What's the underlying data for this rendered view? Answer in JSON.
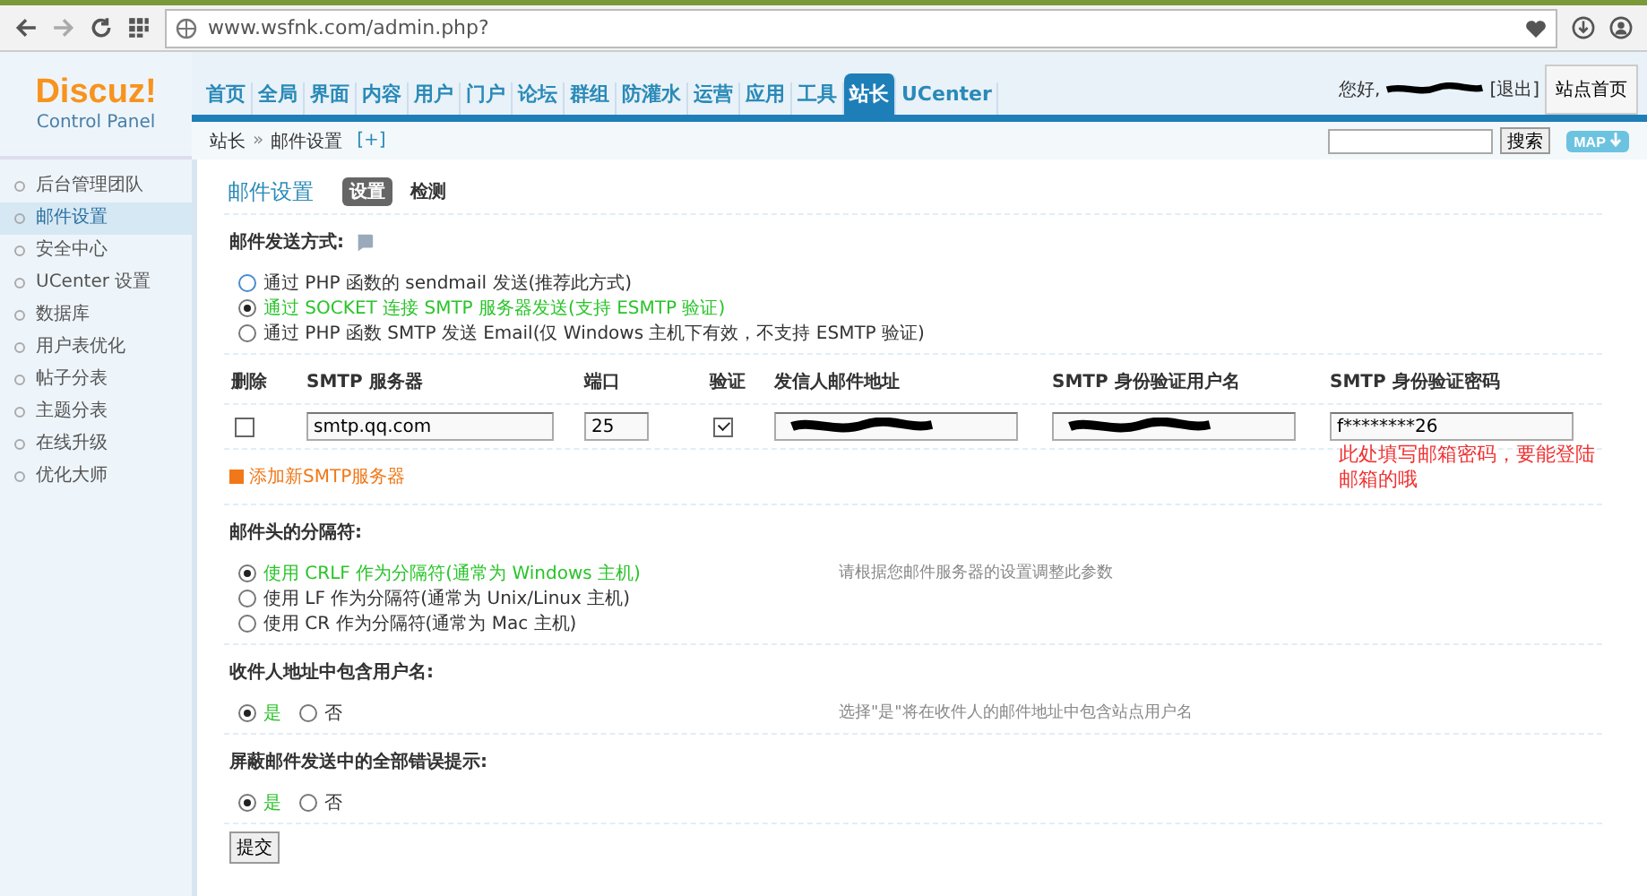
{
  "browser": {
    "url": "www.wsfnk.com/admin.php?"
  },
  "header": {
    "logo": "Discuz!",
    "logo_sub": "Control Panel",
    "greeting": "您好,",
    "logout": "[退出]",
    "home_button": "站点首页"
  },
  "nav": [
    {
      "label": "首页",
      "selected": false
    },
    {
      "label": "全局",
      "selected": false
    },
    {
      "label": "界面",
      "selected": false
    },
    {
      "label": "内容",
      "selected": false
    },
    {
      "label": "用户",
      "selected": false
    },
    {
      "label": "门户",
      "selected": false
    },
    {
      "label": "论坛",
      "selected": false
    },
    {
      "label": "群组",
      "selected": false
    },
    {
      "label": "防灌水",
      "selected": false
    },
    {
      "label": "运营",
      "selected": false
    },
    {
      "label": "应用",
      "selected": false
    },
    {
      "label": "工具",
      "selected": false
    },
    {
      "label": "站长",
      "selected": true
    },
    {
      "label": "UCenter",
      "selected": false
    }
  ],
  "breadcrumb": {
    "parent": "站长",
    "separator": "»",
    "current": "邮件设置",
    "add": "[+]",
    "search_button": "搜索",
    "map_button": "MAP"
  },
  "sidebar": {
    "items": [
      {
        "label": "后台管理团队",
        "selected": false
      },
      {
        "label": "邮件设置",
        "selected": true
      },
      {
        "label": "安全中心",
        "selected": false
      },
      {
        "label": "UCenter 设置",
        "selected": false
      },
      {
        "label": "数据库",
        "selected": false
      },
      {
        "label": "用户表优化",
        "selected": false
      },
      {
        "label": "帖子分表",
        "selected": false
      },
      {
        "label": "主题分表",
        "selected": false
      },
      {
        "label": "在线升级",
        "selected": false
      },
      {
        "label": "优化大师",
        "selected": false
      }
    ]
  },
  "page": {
    "title": "邮件设置",
    "tabs": [
      {
        "label": "设置",
        "selected": true
      },
      {
        "label": "检测",
        "selected": false
      }
    ]
  },
  "send_method": {
    "label": "邮件发送方式:",
    "options": [
      {
        "label": "通过 PHP 函数的 sendmail 发送(推荐此方式)",
        "selected": false
      },
      {
        "label": "通过 SOCKET 连接 SMTP 服务器发送(支持 ESMTP 验证)",
        "selected": true
      },
      {
        "label": "通过 PHP 函数 SMTP 发送 Email(仅 Windows 主机下有效，不支持 ESMTP 验证)",
        "selected": false
      }
    ]
  },
  "smtp_table": {
    "columns": [
      "删除",
      "SMTP 服务器",
      "端口",
      "验证",
      "发信人邮件地址",
      "SMTP 身份验证用户名",
      "SMTP 身份验证密码"
    ],
    "rows": [
      {
        "delete": false,
        "server": "smtp.qq.com",
        "port": "25",
        "auth": true,
        "password": "f********26"
      }
    ],
    "add_link": "添加新SMTP服务器",
    "note": "此处填写邮箱密码，要能登陆邮箱的哦"
  },
  "separator": {
    "label": "邮件头的分隔符:",
    "hint": "请根据您邮件服务器的设置调整此参数",
    "options": [
      {
        "label": "使用 CRLF 作为分隔符(通常为 Windows 主机)",
        "selected": true
      },
      {
        "label": "使用 LF 作为分隔符(通常为 Unix/Linux 主机)",
        "selected": false
      },
      {
        "label": "使用 CR 作为分隔符(通常为 Mac 主机)",
        "selected": false
      }
    ]
  },
  "include_username": {
    "label": "收件人地址中包含用户名:",
    "hint": "选择\"是\"将在收件人的邮件地址中包含站点用户名",
    "options": [
      {
        "label": "是",
        "selected": true
      },
      {
        "label": "否",
        "selected": false
      }
    ]
  },
  "silent_errors": {
    "label": "屏蔽邮件发送中的全部错误提示:",
    "options": [
      {
        "label": "是",
        "selected": true
      },
      {
        "label": "否",
        "selected": false
      }
    ]
  },
  "submit": "提交"
}
